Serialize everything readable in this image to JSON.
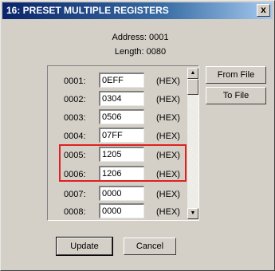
{
  "window": {
    "title": "16: PRESET MULTIPLE REGISTERS",
    "close_label": "x"
  },
  "info": {
    "address": "Address: 0001",
    "length": "Length: 0080"
  },
  "registers": [
    {
      "address": "0001:",
      "value": "0EFF",
      "unit": "(HEX)"
    },
    {
      "address": "0002:",
      "value": "0304",
      "unit": "(HEX)"
    },
    {
      "address": "0003:",
      "value": "0506",
      "unit": "(HEX)"
    },
    {
      "address": "0004:",
      "value": "07FF",
      "unit": "(HEX)"
    },
    {
      "address": "0005:",
      "value": "1205",
      "unit": "(HEX)"
    },
    {
      "address": "0006:",
      "value": "1206",
      "unit": "(HEX)"
    },
    {
      "address": "0007:",
      "value": "0000",
      "unit": "(HEX)"
    },
    {
      "address": "0008:",
      "value": "0000",
      "unit": "(HEX)"
    }
  ],
  "buttons": {
    "from_file": "From File",
    "to_file": "To File",
    "update": "Update",
    "cancel": "Cancel"
  },
  "icons": {
    "scroll_up": "▲",
    "scroll_down": "▼"
  },
  "colors": {
    "highlight": "#e02020",
    "titlebar": "#0a246a"
  }
}
